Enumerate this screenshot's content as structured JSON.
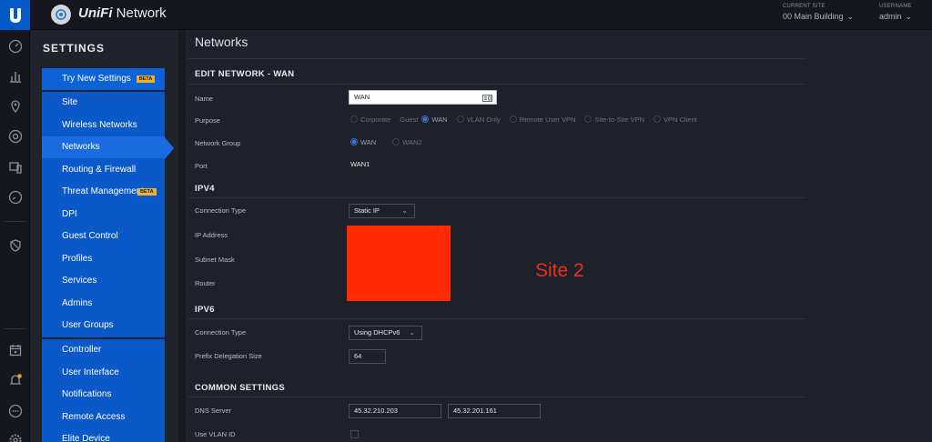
{
  "app": {
    "title_brand": "UniFi",
    "title_product": " Network"
  },
  "header": {
    "site_label": "CURRENT SITE",
    "site_value": "00 Main Building",
    "user_label": "USERNAME",
    "user_value": "admin"
  },
  "rail_icons": [
    "dashboard-icon",
    "statistics-icon",
    "map-icon",
    "devices-icon",
    "clients-icon",
    "insights-icon",
    "shield-icon",
    "calendar-icon",
    "alerts-icon",
    "chat-icon",
    "settings-icon"
  ],
  "sidebar": {
    "heading": "SETTINGS",
    "try_new": "Try New Settings",
    "beta": "BETA",
    "items": [
      "Site",
      "Wireless Networks",
      "Networks",
      "Routing & Firewall",
      "Threat Management",
      "DPI",
      "Guest Control",
      "Profiles",
      "Services",
      "Admins",
      "User Groups"
    ],
    "items2": [
      "Controller",
      "User Interface",
      "Notifications",
      "Remote Access",
      "Elite Device"
    ],
    "active": "Networks"
  },
  "page": {
    "title": "Networks",
    "edit_heading": "EDIT NETWORK - WAN",
    "name_label": "Name",
    "name_value": "WAN",
    "purpose_label": "Purpose",
    "purpose_options": [
      "Corporate",
      "Guest",
      "WAN",
      "VLAN Only",
      "Remote User VPN",
      "Site-to-Site VPN",
      "VPN Client"
    ],
    "purpose_selected": "WAN",
    "network_group_label": "Network Group",
    "network_group_options": [
      "WAN",
      "WAN2"
    ],
    "network_group_selected": "WAN",
    "port_label": "Port",
    "port_value": "WAN1",
    "ipv4_heading": "IPV4",
    "v4_conn_label": "Connection Type",
    "v4_conn_value": "Static IP",
    "ip_label": "IP Address",
    "subnet_label": "Subnet Mask",
    "router_label": "Router",
    "ipv6_heading": "IPV6",
    "v6_conn_label": "Connection Type",
    "v6_conn_value": "Using DHCPv6",
    "prefix_label": "Prefix Delegation Size",
    "prefix_value": "64",
    "common_heading": "COMMON SETTINGS",
    "dns_label": "DNS Server",
    "dns1": "45.32.210.203",
    "dns2": "45.32.201.161",
    "vlan_label": "Use VLAN ID"
  },
  "annotation": "Site 2",
  "colors": {
    "accent": "#0b58c8",
    "redaction": "#ff2a00",
    "annotation": "#e8331a",
    "beta": "#f0b030"
  }
}
